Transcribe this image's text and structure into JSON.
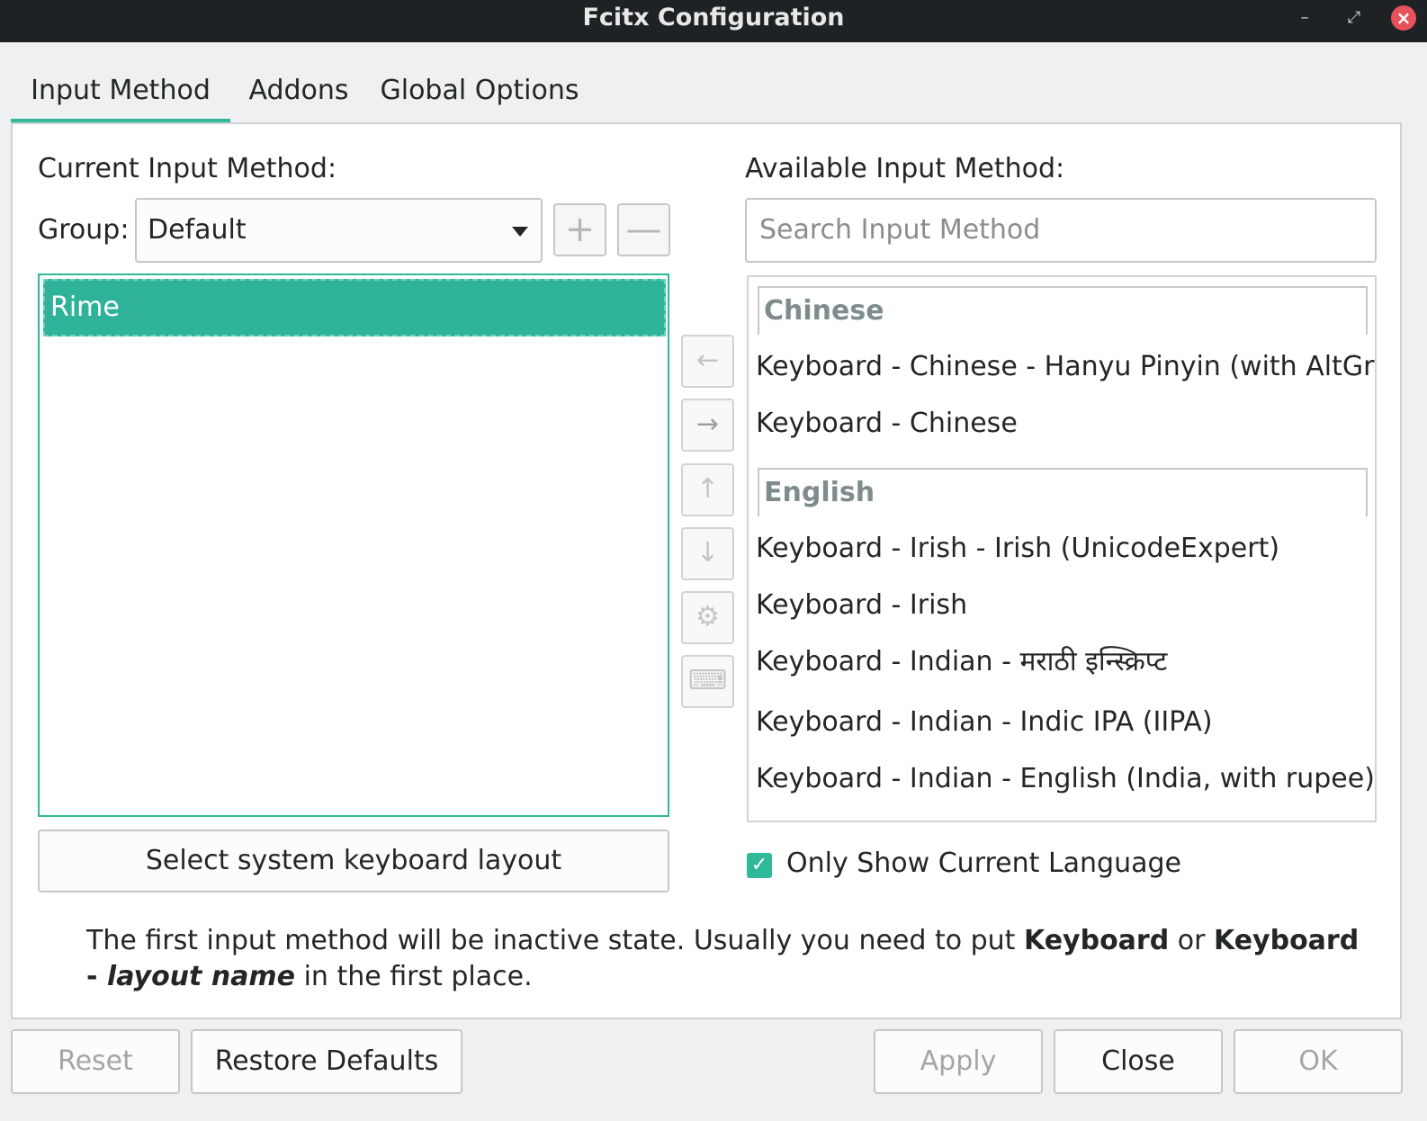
{
  "window": {
    "title": "Fcitx Configuration",
    "controls": {
      "minimize_icon": "minimize-icon",
      "maximize_icon": "maximize-icon",
      "close_icon": "close-icon"
    }
  },
  "tabs": [
    {
      "label": "Input Method",
      "active": true
    },
    {
      "label": "Addons",
      "active": false
    },
    {
      "label": "Global Options",
      "active": false
    }
  ],
  "current": {
    "heading": "Current Input Method:",
    "group_label": "Group:",
    "group_value": "Default",
    "items": [
      "Rime"
    ],
    "select_layout_label": "Select system keyboard layout"
  },
  "available": {
    "heading": "Available Input Method:",
    "search_placeholder": "Search Input Method",
    "groups": [
      {
        "name": "Chinese",
        "items": [
          "Keyboard - Chinese - Hanyu Pinyin (with AltGr ...",
          "Keyboard - Chinese"
        ]
      },
      {
        "name": "English",
        "items": [
          "Keyboard - Irish - Irish (UnicodeExpert)",
          "Keyboard - Irish",
          "Keyboard - Indian - मराठी इन्स्क्रिप्ट",
          "Keyboard - Indian - Indic IPA (IIPA)",
          "Keyboard - Indian - English (India, with rupee)"
        ]
      }
    ],
    "only_current_label": "Only Show Current Language",
    "only_current_checked": true
  },
  "note": {
    "part1": "The first input method will be inactive state. Usually you need to put ",
    "bold1": "Keyboard",
    "part2": " or ",
    "bold2": "Keyboard - ",
    "bold_italic": "layout name",
    "part3": " in the first place."
  },
  "footer": {
    "reset": "Reset",
    "restore": "Restore Defaults",
    "apply": "Apply",
    "close": "Close",
    "ok": "OK"
  },
  "colors": {
    "accent": "#2fb899",
    "titlebar": "#1e2224",
    "close_button": "#e8525a"
  }
}
